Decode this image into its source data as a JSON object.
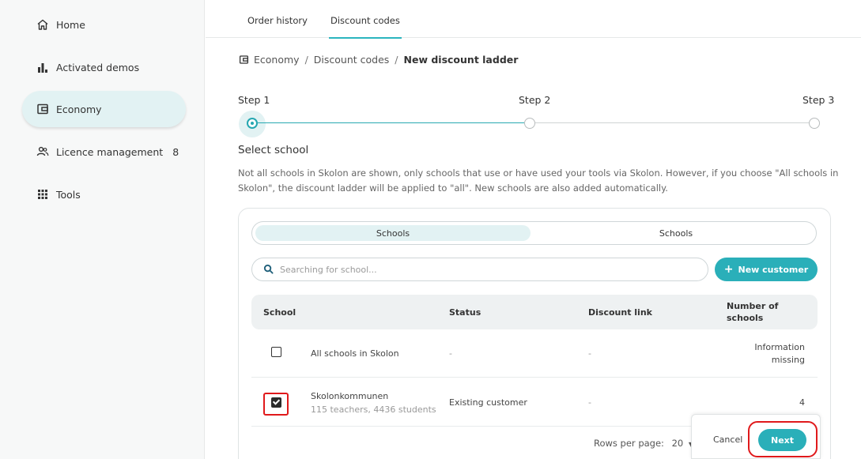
{
  "sidebar": {
    "items": [
      {
        "label": "Home",
        "icon": "home-icon"
      },
      {
        "label": "Activated demos",
        "icon": "bar-chart-icon"
      },
      {
        "label": "Economy",
        "icon": "wallet-icon",
        "active": true
      },
      {
        "label": "Licence management",
        "icon": "users-icon",
        "badge": "8"
      },
      {
        "label": "Tools",
        "icon": "grid-icon"
      }
    ]
  },
  "tabs": [
    {
      "label": "Order history"
    },
    {
      "label": "Discount codes",
      "active": true
    }
  ],
  "breadcrumb": {
    "root": "Economy",
    "separator": "/",
    "middle": "Discount codes",
    "current": "New discount ladder"
  },
  "stepper": {
    "steps": [
      "Step 1",
      "Step 2",
      "Step 3"
    ],
    "active_index": 0
  },
  "section": {
    "title": "Select school",
    "description": "Not all schools in Skolon are shown, only schools that use or have used your tools via Skolon. However, if you choose \"All schools in Skolon\", the discount ladder will be applied to \"all\". New schools are also added automatically."
  },
  "segment": {
    "options": [
      "Schools",
      "Schools"
    ],
    "active_index": 0
  },
  "search": {
    "placeholder": "Searching for school..."
  },
  "new_customer_button": "New customer",
  "table": {
    "headers": {
      "school": "School",
      "status": "Status",
      "discount_link": "Discount link",
      "number_of_schools": "Number of schools"
    },
    "rows": [
      {
        "name": "All schools in Skolon",
        "subtext": "",
        "status": "-",
        "discount_link": "-",
        "number": "Information missing",
        "checked": false
      },
      {
        "name": "Skolonkommunen",
        "subtext": "115 teachers, 4436 students",
        "status": "Existing customer",
        "discount_link": "-",
        "number": "4",
        "checked": true
      }
    ]
  },
  "pagination": {
    "rows_per_page_label": "Rows per page:",
    "rows_per_page_value": "20"
  },
  "actions": {
    "cancel": "Cancel",
    "next": "Next"
  },
  "colors": {
    "accent": "#2aafb9",
    "accent_light": "#e2f2f3",
    "highlight_red": "#e0191b"
  }
}
